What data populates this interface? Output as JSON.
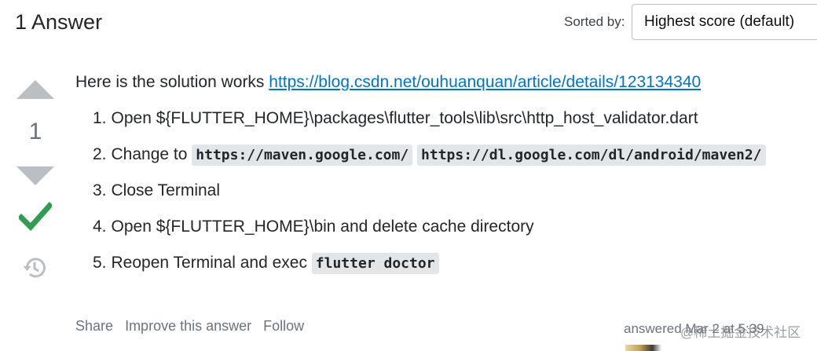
{
  "header": {
    "answer_count": "1 Answer",
    "sorted_label": "Sorted by:",
    "sort_value": "Highest score (default)"
  },
  "vote": {
    "count": "1",
    "accepted": true
  },
  "post": {
    "intro_text": "Here is the solution works ",
    "link_text": "https://blog.csdn.net/ouhuanquan/article/details/123134340",
    "steps": [
      {
        "num": "1.",
        "text": "Open ${FLUTTER_HOME}\\packages\\flutter_tools\\lib\\src\\http_host_validator.dart"
      },
      {
        "num": "2.",
        "text": "Change to ",
        "code1": "https://maven.google.com/",
        "code2": "https://dl.google.com/dl/android/maven2/"
      },
      {
        "num": "3.",
        "text": "Close Terminal"
      },
      {
        "num": "4.",
        "text": "Open ${FLUTTER_HOME}\\bin and delete cache directory"
      },
      {
        "num": "5.",
        "text": "Reopen Terminal and exec ",
        "code1": "flutter doctor"
      }
    ]
  },
  "menu": {
    "share": "Share",
    "improve": "Improve this answer",
    "follow": "Follow"
  },
  "user": {
    "answered": "answered Mar 2 at 5:39"
  },
  "watermark": "@稀土掘金技术社区",
  "icons": {
    "upvote": "upvote-arrow-icon",
    "downvote": "downvote-arrow-icon",
    "accepted": "checkmark-icon",
    "history": "history-icon"
  },
  "colors": {
    "link": "#0074cc",
    "accepted": "#2f9e4f",
    "vote_arrow": "#babfc4",
    "code_bg": "#e3e6e8"
  }
}
